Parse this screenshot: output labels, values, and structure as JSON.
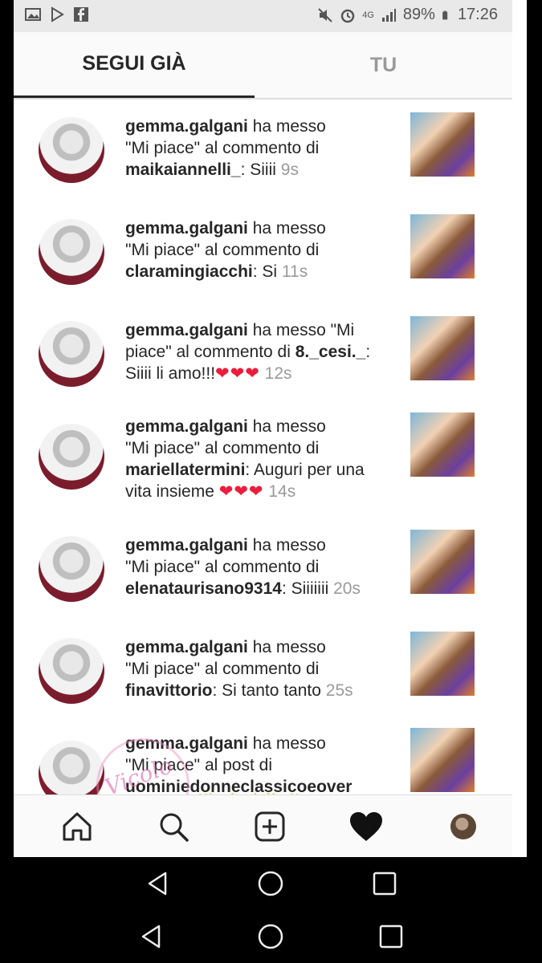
{
  "status_bar": {
    "battery": "89%",
    "time": "17:26",
    "network": "4G"
  },
  "tabs": [
    {
      "label": "SEGUI GIÀ",
      "active": true
    },
    {
      "label": "TU",
      "active": false
    }
  ],
  "feed": [
    {
      "user": "gemma.galgani",
      "line1_rest": " ha messo",
      "line2": "\"Mi piace\" al commento di",
      "target": "maikaiannelli_",
      "comment": ": Siiii",
      "time": "9s"
    },
    {
      "user": "gemma.galgani",
      "line1_rest": " ha messo",
      "line2": "\"Mi piace\" al commento di",
      "target": "claramingiacchi",
      "comment": ": Si",
      "time": "11s"
    },
    {
      "user": "gemma.galgani",
      "line1_rest": " ha messo \"Mi",
      "line2_pre": "piace\" al commento di ",
      "target": "8._cesi._",
      "line3": "Siiii li amo!!!",
      "hearts": "❤❤❤",
      "time": "12s"
    },
    {
      "user": "gemma.galgani",
      "line1_rest": " ha messo",
      "line2": "\"Mi piace\" al commento di",
      "target": "mariellatermini",
      "comment": ": Auguri per una",
      "line4": "vita insieme",
      "hearts": "❤❤❤",
      "time": "14s"
    },
    {
      "user": "gemma.galgani",
      "line1_rest": " ha messo",
      "line2": "\"Mi piace\" al commento di",
      "target": "elenataurisano9314",
      "comment": ": Siiiiiii",
      "time": "20s"
    },
    {
      "user": "gemma.galgani",
      "line1_rest": " ha messo",
      "line2": "\"Mi piace\" al commento di",
      "target": "finavittorio",
      "comment": ": Si tanto tanto",
      "time": "25s"
    },
    {
      "user": "gemma.galgani",
      "line1_rest": " ha messo",
      "line2": "\"Mi piace\" al post di",
      "target": "uominiedonneclassicoeover"
    }
  ],
  "bottom_nav": [
    "home-icon",
    "search-icon",
    "add-post-icon",
    "activity-heart-icon",
    "profile-avatar"
  ],
  "watermark": {
    "text": "Vicolo delle News"
  },
  "colors": {
    "heart": "#ed1c3c",
    "timestamp": "#9a9a9a",
    "text": "#262626"
  }
}
